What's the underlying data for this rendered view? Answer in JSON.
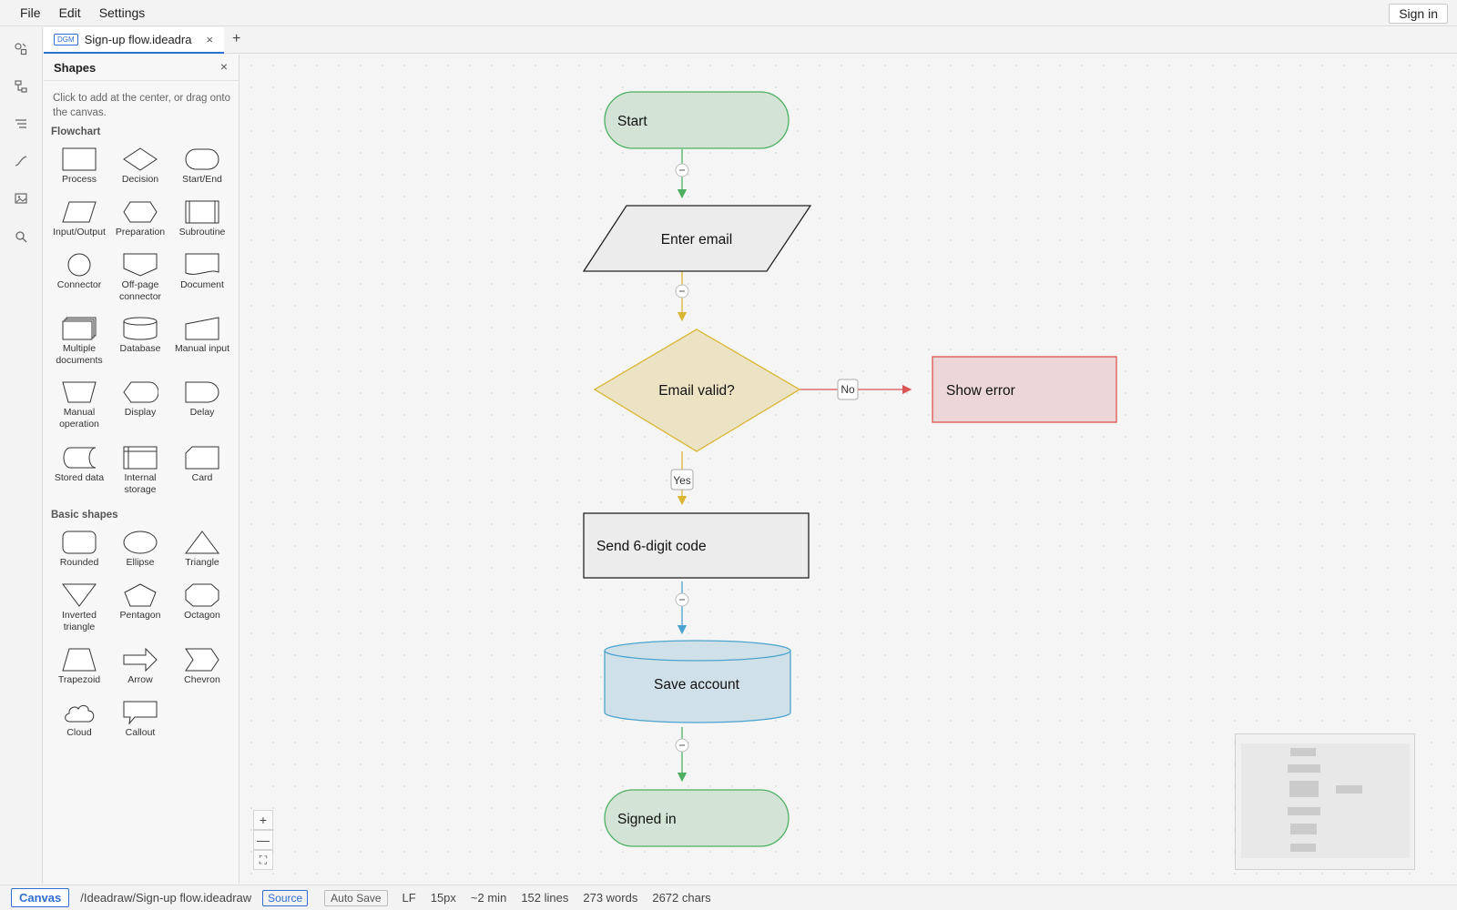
{
  "menubar": {
    "items": [
      "File",
      "Edit",
      "Settings"
    ],
    "signin": "Sign in"
  },
  "activity": {
    "icons": [
      "shapes-icon",
      "diagram-structure-icon",
      "outline-icon",
      "connector-icon",
      "image-icon",
      "search-icon"
    ]
  },
  "tab": {
    "badge": "DGM",
    "title": "Sign-up flow.ideadra",
    "close": "×",
    "add": "+"
  },
  "panel": {
    "title": "Shapes",
    "close": "×",
    "hint": "Click to add at the center, or drag onto the canvas.",
    "sections": {
      "flowchart": "Flowchart",
      "basic": "Basic shapes"
    },
    "flowchart_shapes": [
      "Process",
      "Decision",
      "Start/End",
      "Input/Output",
      "Preparation",
      "Subroutine",
      "Connector",
      "Off-page connector",
      "Document",
      "Multiple documents",
      "Database",
      "Manual input",
      "Manual operation",
      "Display",
      "Delay",
      "Stored data",
      "Internal storage",
      "Card"
    ],
    "basic_shapes": [
      "Rounded",
      "Ellipse",
      "Triangle",
      "Inverted triangle",
      "Pentagon",
      "Octagon",
      "Trapezoid",
      "Arrow",
      "Chevron",
      "Cloud",
      "Callout"
    ]
  },
  "diagram": {
    "nodes": {
      "start": "Start",
      "enter_email": "Enter email",
      "email_valid": "Email valid?",
      "show_error": "Show error",
      "send_code": "Send 6-digit code",
      "save_account": "Save account",
      "signed_in": "Signed in"
    },
    "edge_labels": {
      "no": "No",
      "yes": "Yes"
    },
    "colors": {
      "green_fill": "#d3e4d6",
      "green_stroke": "#4caf62",
      "yellow_fill": "#ebe3c4",
      "yellow_stroke": "#d9b531",
      "red_fill": "#ecd6d8",
      "red_stroke": "#d95555",
      "blue_fill": "#cfe0e8",
      "blue_stroke": "#4ba3cf",
      "gray_fill": "#ececec",
      "gray_stroke": "#222222"
    }
  },
  "zoom": {
    "in": "+",
    "out": "—",
    "fit": "⛶"
  },
  "status": {
    "mode": "Canvas",
    "path": "/Ideadraw/Sign-up flow.ideadraw",
    "source": "Source",
    "autosave": "Auto Save",
    "line_ending": "LF",
    "font_size": "15px",
    "read_time": "~2 min",
    "lines": "152 lines",
    "words": "273 words",
    "chars": "2672 chars"
  }
}
